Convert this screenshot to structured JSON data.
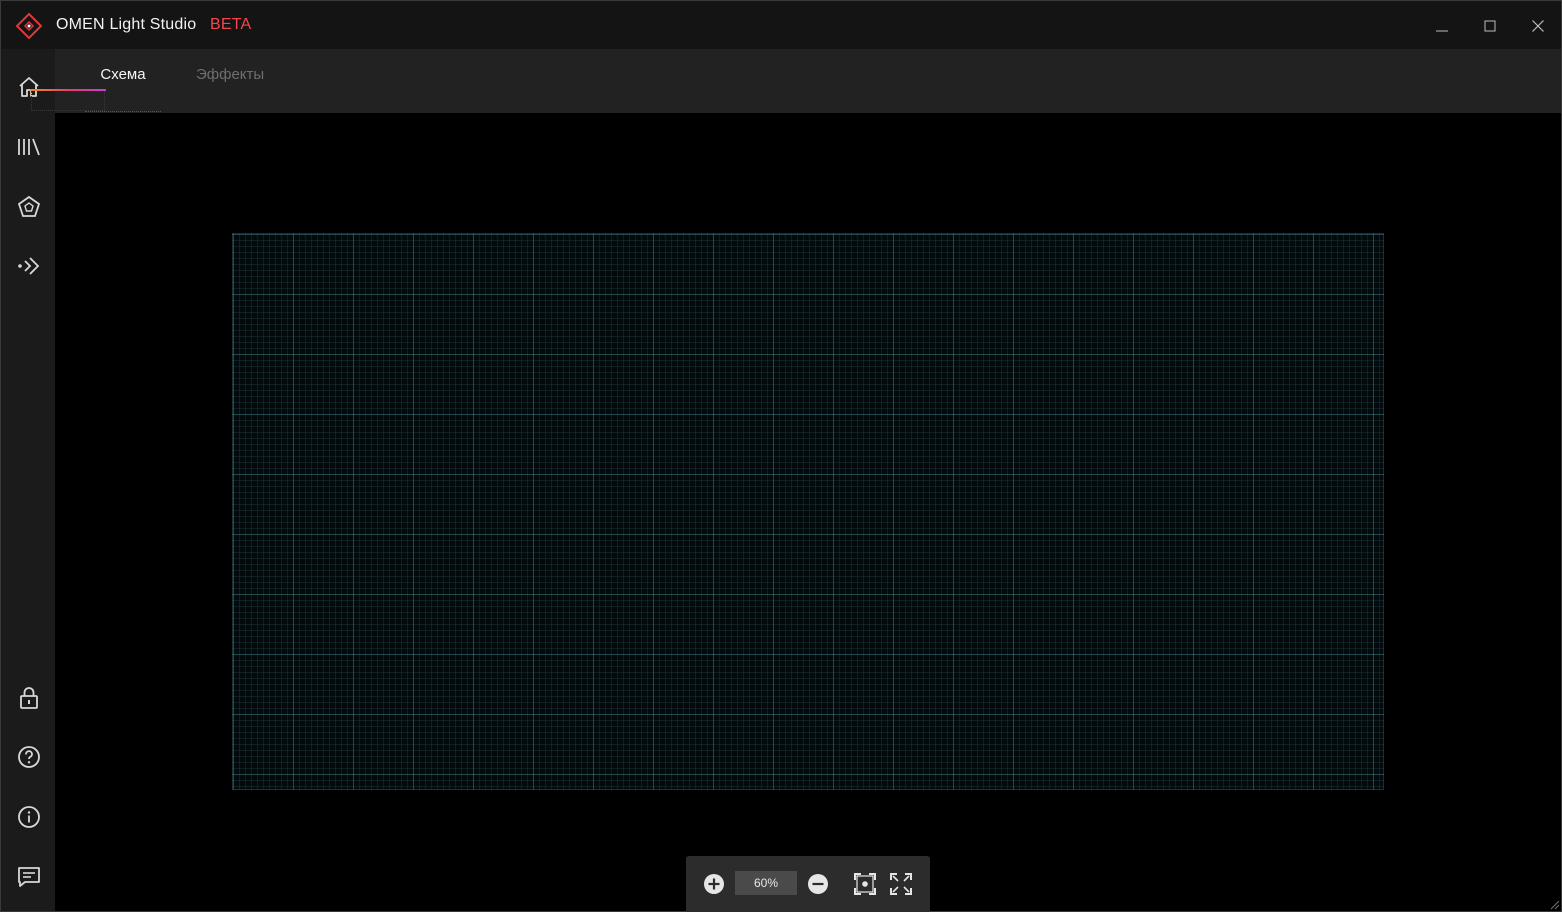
{
  "app": {
    "title": "OMEN Light Studio",
    "badge": "BETA",
    "accent_color": "#f0484d"
  },
  "window_controls": {
    "minimize": "minimize-icon",
    "maximize": "maximize-icon",
    "close": "close-icon"
  },
  "sidebar": {
    "top_items": [
      {
        "icon": "home-icon"
      },
      {
        "icon": "library-icon"
      },
      {
        "icon": "omen-pentagon-icon"
      },
      {
        "icon": "sync-signal-icon"
      }
    ],
    "bottom_items": [
      {
        "icon": "lock-icon"
      },
      {
        "icon": "help-icon"
      },
      {
        "icon": "info-icon"
      },
      {
        "icon": "feedback-icon"
      }
    ]
  },
  "tabs": [
    {
      "label": "Схема",
      "active": true
    },
    {
      "label": "Эффекты",
      "active": false
    }
  ],
  "zoom": {
    "value": "60%",
    "zoom_in_icon": "zoom-in-icon",
    "zoom_out_icon": "zoom-out-icon",
    "fit_icon": "fit-to-screen-icon",
    "expand_icon": "expand-icon"
  },
  "colors": {
    "tab_gradient": [
      "#f08a24",
      "#e63b6f",
      "#c43dd6"
    ],
    "grid_line": "#3c7882"
  }
}
